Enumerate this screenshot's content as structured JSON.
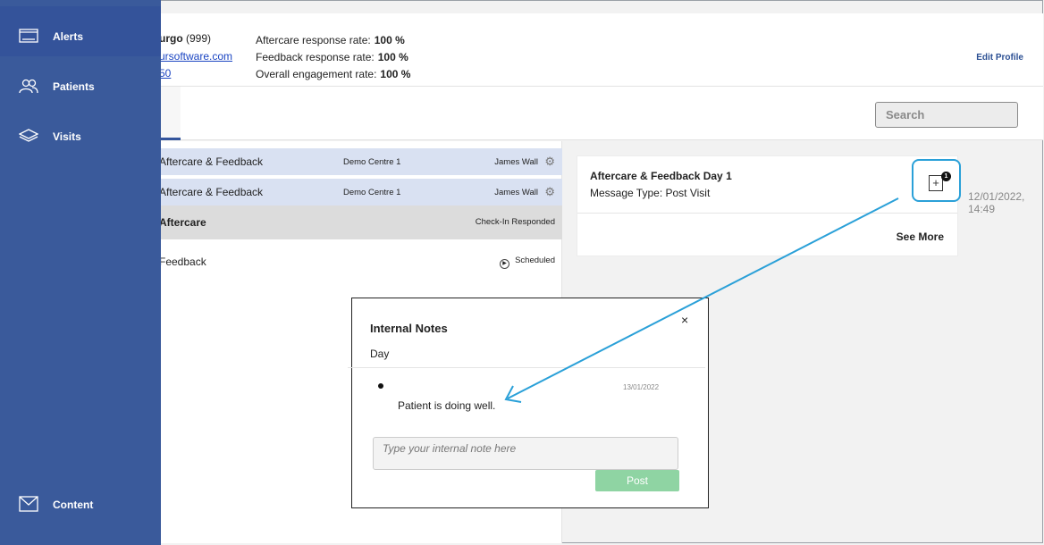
{
  "profile": {
    "name": "urgo",
    "id": "(999)",
    "email": "ursoftware.com",
    "phone": "50",
    "rates": [
      {
        "label": "Aftercare response rate:",
        "value": "100 %"
      },
      {
        "label": "Feedback response rate:",
        "value": "100 %"
      },
      {
        "label": "Overall engagement rate:",
        "value": "100 %"
      }
    ],
    "edit_label": "Edit Profile"
  },
  "search": {
    "placeholder": "Search"
  },
  "sidebar": {
    "items": [
      {
        "label": "Alerts",
        "icon": "alerts-icon"
      },
      {
        "label": "Patients",
        "icon": "patients-icon"
      },
      {
        "label": "Visits",
        "icon": "layers-icon"
      },
      {
        "label": "Content",
        "icon": "envelope-icon"
      }
    ]
  },
  "visits": [
    {
      "title": "Aftercare & Feedback",
      "centre": "Demo Centre 1",
      "staff": "James Wall"
    },
    {
      "title": "Aftercare & Feedback",
      "centre": "Demo Centre 1",
      "staff": "James Wall"
    },
    {
      "title": "Aftercare",
      "status": "Check-In Responded"
    },
    {
      "title": "Feedback",
      "status": "Scheduled"
    }
  ],
  "detail": {
    "title": "Aftercare & Feedback Day 1",
    "type": "Message Type: Post Visit",
    "date": "12/01/2022,",
    "time": "14:49",
    "see_more": "See More",
    "note_count": "1"
  },
  "dialog": {
    "title": "Internal Notes",
    "subtitle": "Day",
    "close": "×",
    "note_text": "Patient is doing well.",
    "note_date": "13/01/2022",
    "input_placeholder": "Type your internal note here",
    "post_label": "Post"
  },
  "colors": {
    "sidebar": "#3a5a9b",
    "accent": "#2aa0d8",
    "post_button": "#8fd4a3",
    "row_highlight": "#d9e1f2"
  }
}
